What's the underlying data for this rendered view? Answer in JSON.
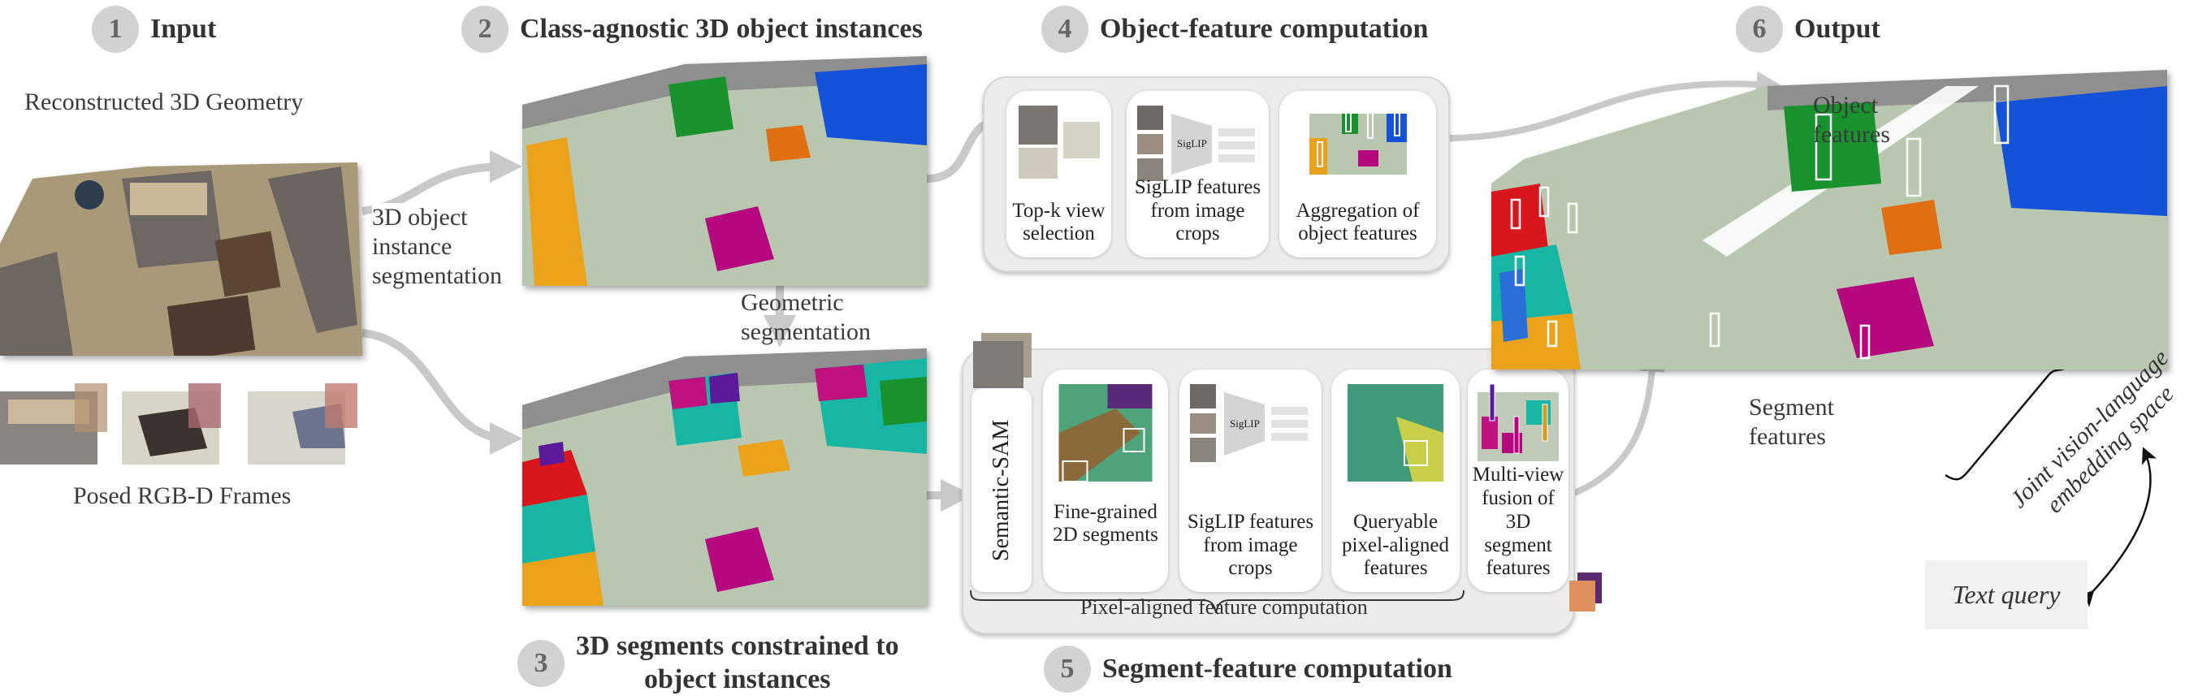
{
  "steps": [
    {
      "number": "1",
      "title": "Input"
    },
    {
      "number": "2",
      "title": "Class-agnostic 3D object instances"
    },
    {
      "number": "3",
      "title_lines": [
        "3D segments constrained to",
        "object instances"
      ]
    },
    {
      "number": "4",
      "title": "Object-feature computation"
    },
    {
      "number": "5",
      "title": "Segment-feature computation"
    },
    {
      "number": "6",
      "title": "Output"
    }
  ],
  "input": {
    "geometry_label": "Reconstructed 3D Geometry",
    "frames_label": "Posed RGB-D Frames"
  },
  "edges": {
    "instance_segmentation": [
      "3D object",
      "instance",
      "segmentation"
    ],
    "geometric_segmentation": [
      "Geometric",
      "segmentation"
    ]
  },
  "object_features": {
    "cards": [
      {
        "label": "Top-k view selection"
      },
      {
        "label": "SigLIP features from image crops",
        "model": "SigLIP"
      },
      {
        "label": "Aggregation of object features"
      }
    ]
  },
  "segment_features": {
    "sam_label": "Semantic-SAM",
    "cards": [
      {
        "label": "Fine-grained 2D segments"
      },
      {
        "label": "SigLIP features from image crops",
        "model": "SigLIP"
      },
      {
        "label": "Queryable pixel-aligned features"
      },
      {
        "label": "Multi-view fusion of 3D segment features"
      }
    ],
    "group_label": "Pixel-aligned feature computation"
  },
  "output": {
    "object_features_label": [
      "Object",
      "features"
    ],
    "segment_features_label": [
      "Segment",
      "features"
    ],
    "embedding_label": [
      "Joint vision-language",
      "embedding space"
    ],
    "text_query": "Text query"
  },
  "colors": {
    "arrow": "#c9c9c9",
    "panel": "#ececec",
    "step_circle": "#d2d2d2",
    "floor": "#b9c7b0",
    "orange": "#e9a21a",
    "green": "#17922c",
    "blue": "#1452d8",
    "magenta": "#b5077e",
    "teal": "#16b5a4",
    "red": "#d8161e",
    "purple": "#5a1a9a"
  }
}
